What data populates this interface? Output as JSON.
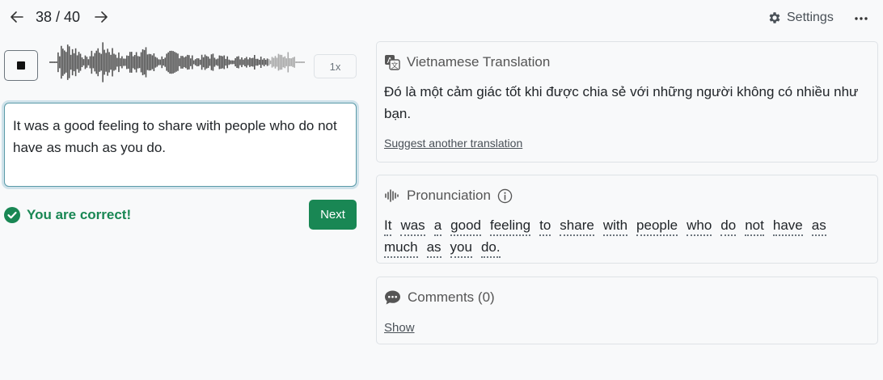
{
  "nav": {
    "counter": "38 / 40",
    "settings_label": "Settings"
  },
  "player": {
    "speed_label": "1x"
  },
  "answer": {
    "text": "It was a good feeling to share with people who do not have as much as you do."
  },
  "feedback": {
    "message": "You are correct!",
    "next_label": "Next",
    "color": "#198754"
  },
  "translation": {
    "title": "Vietnamese Translation",
    "text": "Đó là một cảm giác tốt khi được chia sẻ với những người không có nhiều như bạn.",
    "suggest_label": "Suggest another translation"
  },
  "pronunciation": {
    "title": "Pronunciation",
    "words": [
      "It",
      "was",
      "a",
      "good",
      "feeling",
      "to",
      "share",
      "with",
      "people",
      "who",
      "do",
      "not",
      "have",
      "as",
      "much",
      "as",
      "you",
      "do."
    ]
  },
  "comments": {
    "title": "Comments (0)",
    "show_label": "Show"
  },
  "icons": {
    "prev": "arrow-left-icon",
    "next": "arrow-right-icon",
    "settings": "gear-icon",
    "more": "ellipsis-icon",
    "stop": "stop-icon",
    "correct": "check-circle-icon",
    "translation": "translate-icon",
    "pronunciation": "sound-wave-icon",
    "info": "info-icon",
    "comments": "chat-bubble-icon"
  }
}
